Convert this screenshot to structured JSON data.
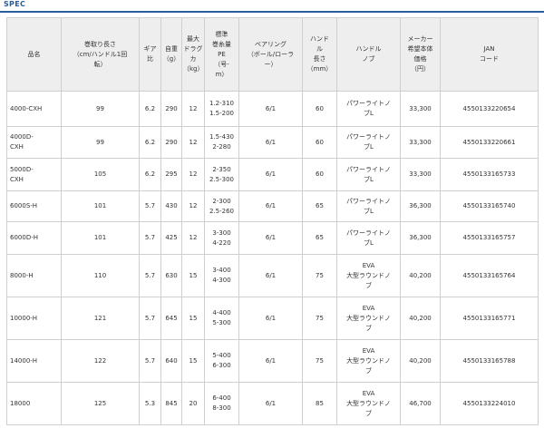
{
  "page": {
    "title": "SPEC"
  },
  "headers": {
    "name": "品名",
    "retrieve": [
      "巻取り長さ",
      "（cm/ハンドル1回",
      "転）"
    ],
    "gear": [
      "ギア",
      "比"
    ],
    "weight": [
      "自重",
      "（g）"
    ],
    "drag": [
      "最大",
      "ドラグ",
      "カ",
      "（kg）"
    ],
    "line": [
      "標準",
      "巻糸量",
      "PE",
      "（号-",
      "m）"
    ],
    "bearing": [
      "ベアリング",
      "（ボール/ローラ",
      "ー）"
    ],
    "handle_len": [
      "ハンド",
      "ル",
      "長さ",
      "（mm）"
    ],
    "knob": [
      "ハンドル",
      "ノブ"
    ],
    "price": [
      "メーカー",
      "希望本体",
      "価格",
      "（円）"
    ],
    "jan": [
      "JAN",
      "コード"
    ]
  },
  "rows": [
    {
      "name": [
        "4000-CXH"
      ],
      "retrieve": "99",
      "gear": "6.2",
      "weight": "290",
      "drag": "12",
      "line": [
        "1.2-310",
        "1.5-200"
      ],
      "bearing": "6/1",
      "handle": "60",
      "knob": [
        "パワーライトノ",
        "ブL"
      ],
      "price": "33,300",
      "jan": "4550133220654"
    },
    {
      "name": [
        "4000D-",
        "CXH"
      ],
      "retrieve": "99",
      "gear": "6.2",
      "weight": "290",
      "drag": "12",
      "line": [
        "1.5-430",
        "2-280"
      ],
      "bearing": "6/1",
      "handle": "60",
      "knob": [
        "パワーライトノ",
        "ブL"
      ],
      "price": "33,300",
      "jan": "4550133220661"
    },
    {
      "name": [
        "5000D-",
        "CXH"
      ],
      "retrieve": "105",
      "gear": "6.2",
      "weight": "295",
      "drag": "12",
      "line": [
        "2-350",
        "2.5-300"
      ],
      "bearing": "6/1",
      "handle": "60",
      "knob": [
        "パワーライトノ",
        "ブL"
      ],
      "price": "33,300",
      "jan": "4550133165733"
    },
    {
      "name": [
        "6000S-H"
      ],
      "retrieve": "101",
      "gear": "5.7",
      "weight": "430",
      "drag": "12",
      "line": [
        "2-300",
        "2.5-260"
      ],
      "bearing": "6/1",
      "handle": "65",
      "knob": [
        "パワーライトノ",
        "ブL"
      ],
      "price": "36,300",
      "jan": "4550133165740"
    },
    {
      "name": [
        "6000D-H"
      ],
      "retrieve": "101",
      "gear": "5.7",
      "weight": "425",
      "drag": "12",
      "line": [
        "3-300",
        "4-220"
      ],
      "bearing": "6/1",
      "handle": "65",
      "knob": [
        "パワーライトノ",
        "ブL"
      ],
      "price": "36,300",
      "jan": "4550133165757"
    },
    {
      "name": [
        "8000-H"
      ],
      "retrieve": "110",
      "gear": "5.7",
      "weight": "630",
      "drag": "15",
      "line": [
        "3-400",
        "4-300"
      ],
      "bearing": "6/1",
      "handle": "75",
      "knob": [
        "EVA",
        "大型ラウンドノ",
        "ブ"
      ],
      "price": "40,200",
      "jan": "4550133165764"
    },
    {
      "name": [
        "10000-H"
      ],
      "retrieve": "121",
      "gear": "5.7",
      "weight": "645",
      "drag": "15",
      "line": [
        "4-400",
        "5-300"
      ],
      "bearing": "6/1",
      "handle": "75",
      "knob": [
        "EVA",
        "大型ラウンドノ",
        "ブ"
      ],
      "price": "40,200",
      "jan": "4550133165771"
    },
    {
      "name": [
        "14000-H"
      ],
      "retrieve": "122",
      "gear": "5.7",
      "weight": "640",
      "drag": "15",
      "line": [
        "5-400",
        "6-300"
      ],
      "bearing": "6/1",
      "handle": "75",
      "knob": [
        "EVA",
        "大型ラウンドノ",
        "ブ"
      ],
      "price": "40,200",
      "jan": "4550133165788"
    },
    {
      "name": [
        "18000"
      ],
      "retrieve": "125",
      "gear": "5.3",
      "weight": "845",
      "drag": "20",
      "line": [
        "6-400",
        "8-300"
      ],
      "bearing": "6/1",
      "handle": "85",
      "knob": [
        "EVA",
        "大型ラウンドノ",
        "ブ"
      ],
      "price": "46,700",
      "jan": "4550133224010"
    }
  ]
}
